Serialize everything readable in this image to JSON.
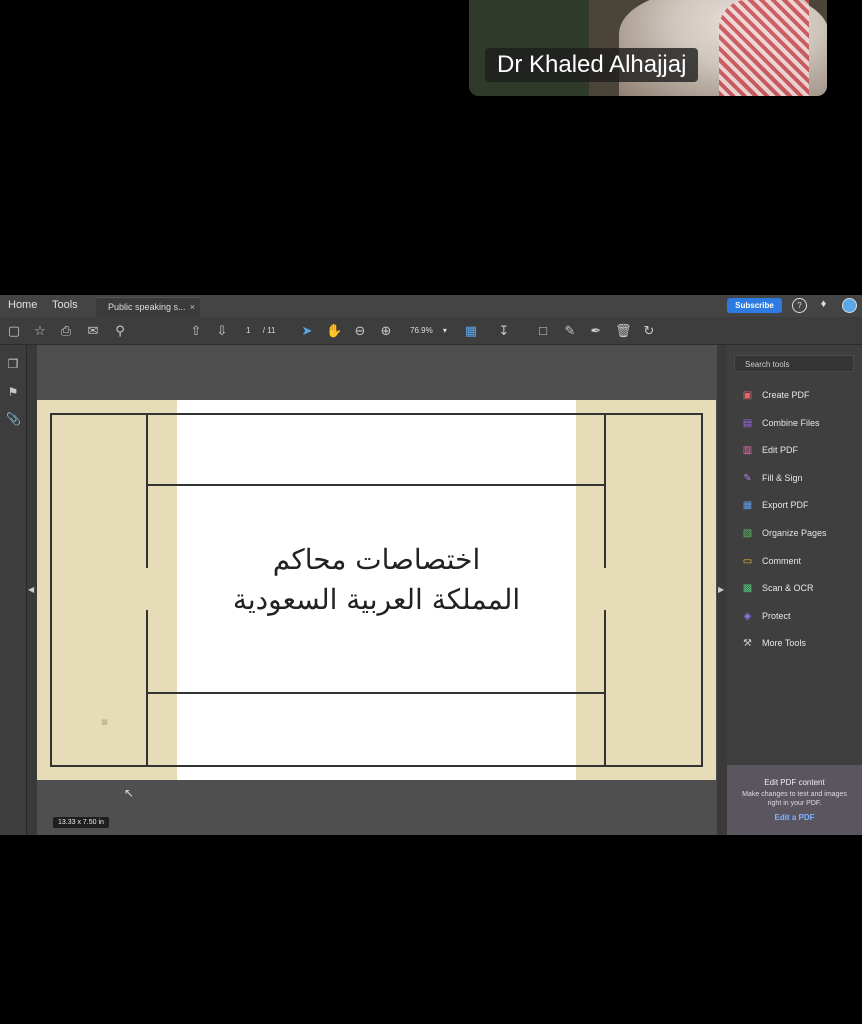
{
  "video": {
    "speaker_name": "Dr Khaled Alhajjaj"
  },
  "menubar": {
    "home": "Home",
    "tools": "Tools",
    "tab_title": "Public speaking s...",
    "tab_close": "×",
    "subscribe": "Subscribe"
  },
  "toolbar": {
    "page_current": "1",
    "page_total": "/ 11",
    "zoom": "76.9%"
  },
  "slide": {
    "line1": "اختصاصات محاكم",
    "line2": "المملكة العربية السعودية"
  },
  "status": {
    "page_size": "13.33 x 7.50 in"
  },
  "tools_panel": {
    "search_placeholder": "Search tools",
    "items": [
      {
        "label": "Create PDF",
        "color": "#e5656a"
      },
      {
        "label": "Combine Files",
        "color": "#9a6ee8"
      },
      {
        "label": "Edit PDF",
        "color": "#e86ab0"
      },
      {
        "label": "Fill & Sign",
        "color": "#b27de9"
      },
      {
        "label": "Export PDF",
        "color": "#5b9cf0"
      },
      {
        "label": "Organize Pages",
        "color": "#5dbb63"
      },
      {
        "label": "Comment",
        "color": "#e8c33a"
      },
      {
        "label": "Scan & OCR",
        "color": "#4cc476"
      },
      {
        "label": "Protect",
        "color": "#8a7df0"
      },
      {
        "label": "More Tools",
        "color": "#cccccc"
      }
    ],
    "promo_title": "Edit PDF content",
    "promo_desc": "Make changes to text and images right in your PDF.",
    "promo_link": "Edit a PDF"
  }
}
